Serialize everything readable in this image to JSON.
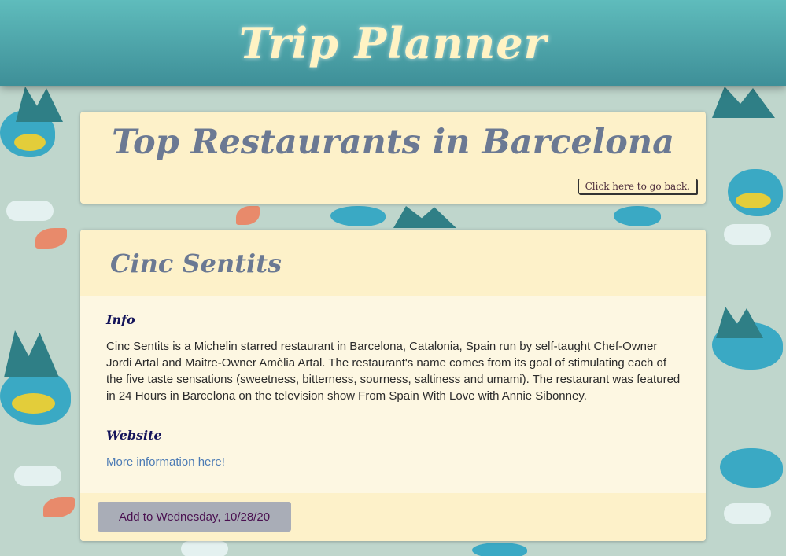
{
  "header": {
    "app_title": "Trip Planner"
  },
  "page": {
    "title": "Top Restaurants in Barcelona",
    "back_button_label": "Click here to go back."
  },
  "restaurant": {
    "name": "Cinc Sentits",
    "info_heading": "Info",
    "info_text": "Cinc Sentits is a Michelin starred restaurant in Barcelona, Catalonia, Spain run by self-taught Chef-Owner Jordi Artal and Maitre-Owner Amèlia Artal. The restaurant's name comes from its goal of stimulating each of the five taste sensations (sweetness, bitterness, sourness, saltiness and umami). The restaurant was featured in 24 Hours in Barcelona on the television show From Spain With Love with Annie Sibonney.",
    "website_heading": "Website",
    "website_link_label": "More information here!",
    "add_button_label": "Add to Wednesday, 10/28/20"
  },
  "colors": {
    "header_teal": "#4aa5ab",
    "title_cream": "#fff3c4",
    "card_cream": "#fdf1c9",
    "title_slate": "#6b7993",
    "link_blue": "#4c7bb5",
    "button_gray": "#a9adb7"
  }
}
